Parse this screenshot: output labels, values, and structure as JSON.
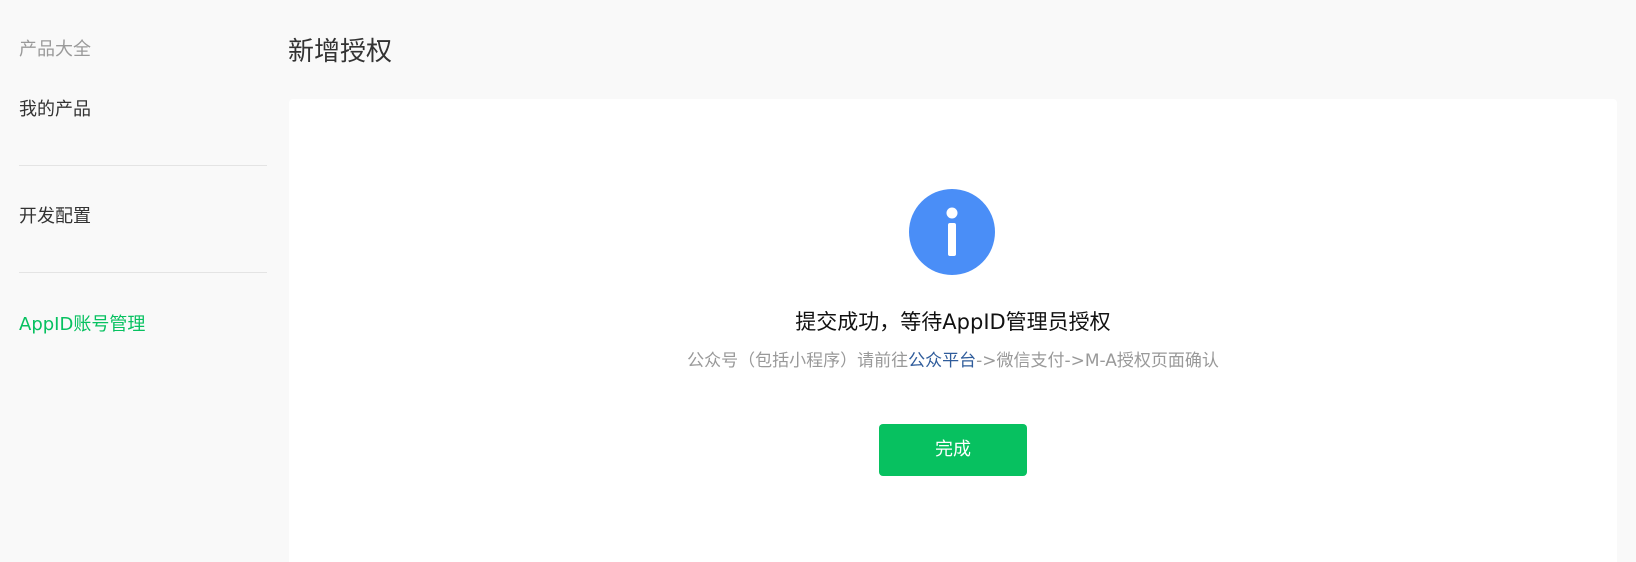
{
  "sidebar": {
    "heading": "产品大全",
    "items": [
      {
        "label": "我的产品",
        "active": false
      },
      {
        "label": "开发配置",
        "active": false
      },
      {
        "label": "AppID账号管理",
        "active": true
      }
    ]
  },
  "main": {
    "title": "新增授权",
    "result": {
      "icon": "info-icon",
      "title": "提交成功，等待AppID管理员授权",
      "desc_prefix": "公众号（包括小程序）请前往",
      "desc_link": "公众平台",
      "desc_suffix": "->微信支付->M-A授权页面确认",
      "button_label": "完成"
    }
  },
  "colors": {
    "accent_green": "#07c160",
    "info_blue": "#4a8ef7",
    "link_blue": "#2f5c9b"
  }
}
